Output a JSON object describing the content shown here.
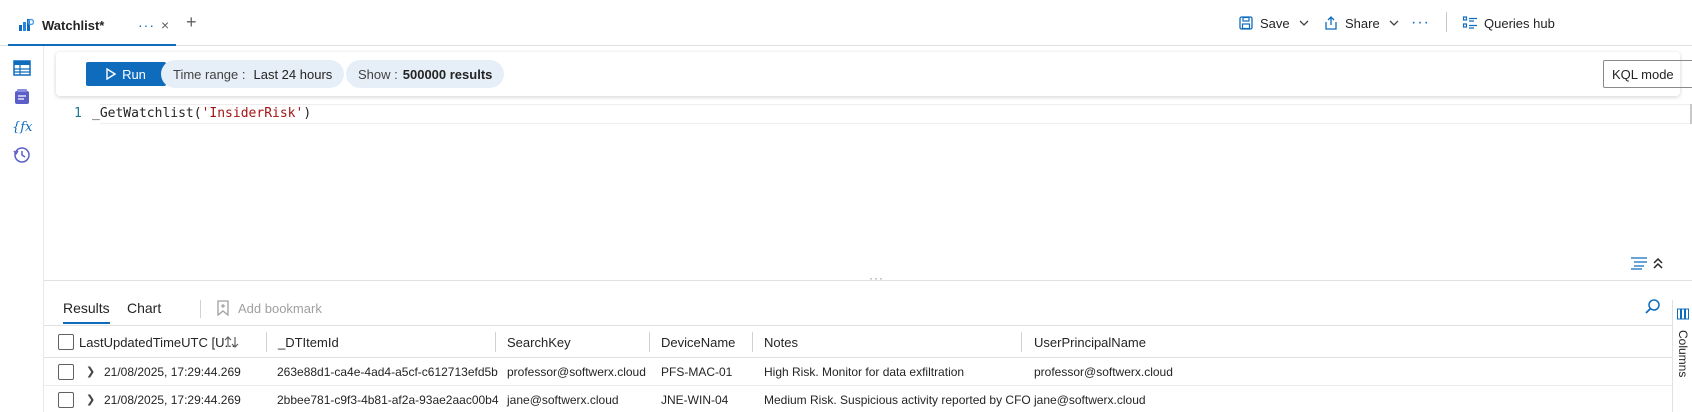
{
  "tab": {
    "title": "Watchlist*",
    "more": "···",
    "close": "×",
    "add": "+"
  },
  "commands": {
    "save": "Save",
    "share": "Share",
    "more": "···",
    "queries_hub": "Queries hub"
  },
  "toolbar": {
    "run": "Run",
    "time_range_label": "Time range :",
    "time_range_value": "Last 24 hours",
    "show_label": "Show :",
    "show_value": "500000 results",
    "mode": "KQL mode"
  },
  "editor": {
    "line_number": "1",
    "code_prefix": "_GetWatchlist(",
    "code_string": "'InsiderRisk'",
    "code_suffix": ")"
  },
  "splitter": "···",
  "results": {
    "tabs": [
      "Results",
      "Chart"
    ],
    "add_bookmark": "Add bookmark",
    "columns_panel": "Columns",
    "columns": [
      "LastUpdatedTimeUTC [U...",
      "_DTItemId",
      "SearchKey",
      "DeviceName",
      "Notes",
      "UserPrincipalName"
    ],
    "rows": [
      [
        "21/08/2025, 17:29:44.269",
        "263e88d1-ca4e-4ad4-a5cf-c612713efd5b",
        "professor@softwerx.cloud",
        "PFS-MAC-01",
        "High Risk. Monitor for data exfiltration",
        "professor@softwerx.cloud"
      ],
      [
        "21/08/2025, 17:29:44.269",
        "2bbee781-c9f3-4b81-af2a-93ae2aac00b4",
        "jane@softwerx.cloud",
        "JNE-WIN-04",
        "Medium Risk. Suspicious activity reported by CFO",
        "jane@softwerx.cloud"
      ]
    ]
  },
  "colors": {
    "accent": "#0f6cbd",
    "pill": "#e6eff8",
    "string": "#a31515"
  }
}
